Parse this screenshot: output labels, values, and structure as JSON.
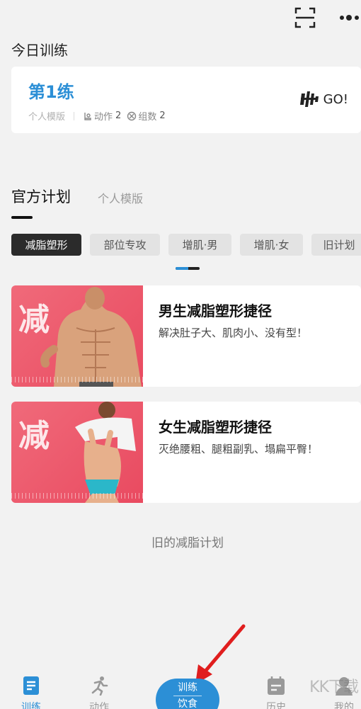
{
  "header": {
    "scan_icon": "scan-icon",
    "more_icon": "more-icon"
  },
  "today": {
    "section_title": "今日训练",
    "card": {
      "plan_name": "第1练",
      "template_label": "个人模版",
      "actions_label": "动作",
      "actions_count": "2",
      "sets_label": "组数",
      "sets_count": "2",
      "go_label": "GO!"
    }
  },
  "tabs": [
    {
      "label": "官方计划",
      "active": true
    },
    {
      "label": "个人模版",
      "active": false
    }
  ],
  "chips": [
    {
      "label": "减脂塑形",
      "active": true
    },
    {
      "label": "部位专攻",
      "active": false
    },
    {
      "label": "增肌·男",
      "active": false
    },
    {
      "label": "增肌·女",
      "active": false
    },
    {
      "label": "旧计划",
      "active": false
    }
  ],
  "plans": [
    {
      "thumb_char": "减",
      "title": "男生减脂塑形捷径",
      "desc": "解决肚子大、肌肉小、没有型！"
    },
    {
      "thumb_char": "减",
      "title": "女生减脂塑形捷径",
      "desc": "灭绝腰粗、腿粗副乳、塌扁平臀！"
    }
  ],
  "old_plans_link": "旧的减脂计划",
  "bottom_nav": {
    "items": [
      {
        "label": "训练",
        "icon": "document-icon",
        "active": true
      },
      {
        "label": "动作",
        "icon": "running-icon",
        "active": false
      },
      {
        "label": "历史",
        "icon": "calendar-icon",
        "active": false
      },
      {
        "label": "我的",
        "icon": "person-icon",
        "active": false
      }
    ],
    "center": {
      "line1": "训练",
      "line2": "饮食"
    }
  },
  "watermark": "KK下载",
  "colors": {
    "accent": "#2c8fd6",
    "thumb": "#ee5a6e",
    "arrow": "#e01e1e"
  }
}
